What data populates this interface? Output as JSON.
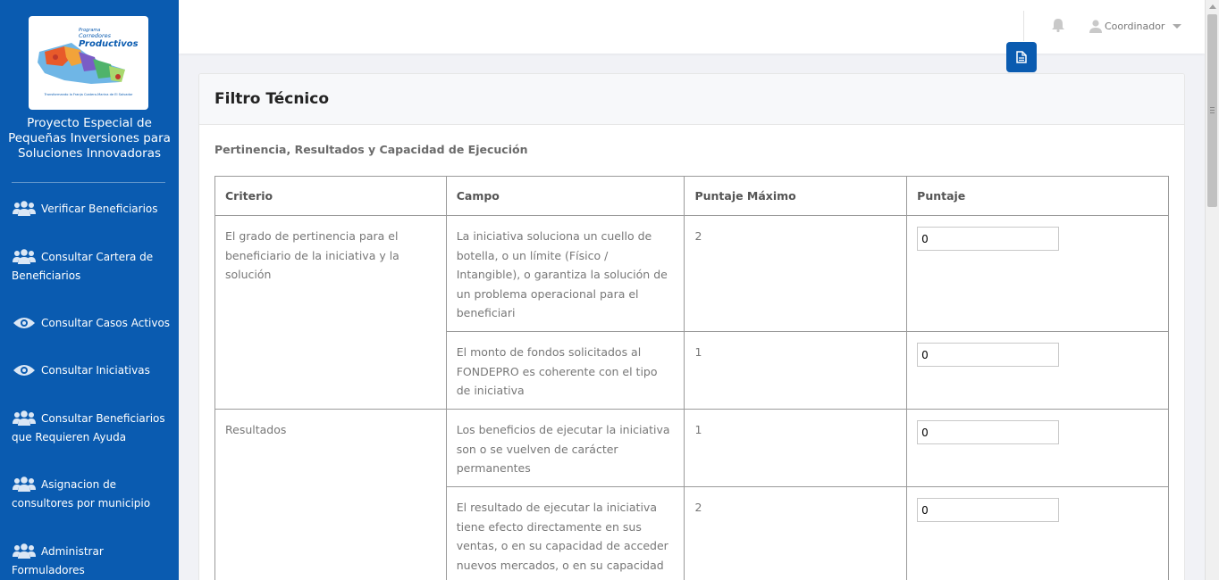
{
  "sidebar": {
    "logo": {
      "line1": "Programa",
      "line2": "Corredores",
      "line3": "Productivos",
      "tagline": "Transformando la Franja Costero-Marina de El Salvador"
    },
    "title": "Proyecto Especial de Pequeñas Inversiones para Soluciones Innovadoras",
    "items": [
      {
        "icon": "users-icon",
        "label": "Verificar Beneficiarios"
      },
      {
        "icon": "users-icon",
        "label": "Consultar Cartera de Beneficiarios"
      },
      {
        "icon": "eye-icon",
        "label": "Consultar Casos Activos"
      },
      {
        "icon": "eye-icon",
        "label": "Consultar Iniciativas"
      },
      {
        "icon": "users-icon",
        "label": "Consultar Beneficiarios que Requieren Ayuda"
      },
      {
        "icon": "users-icon",
        "label": "Asignacion de consultores por municipio"
      },
      {
        "icon": "users-icon",
        "label": "Administrar Formuladores"
      }
    ]
  },
  "topbar": {
    "user_name": "Coordinador",
    "icons": [
      "bell-icon",
      "user-icon",
      "document-icon"
    ]
  },
  "card": {
    "title": "Filtro Técnico",
    "section": "Pertinencia, Resultados y Capacidad de Ejecución",
    "columns": [
      "Criterio",
      "Campo",
      "Puntaje Máximo",
      "Puntaje"
    ],
    "criteria": [
      {
        "label": "El grado de pertinencia para el beneficiario de la iniciativa y la solución"
      },
      {
        "label": "Resultados"
      }
    ],
    "rows": [
      {
        "campo": "La iniciativa soluciona un cuello de botella, o un límite (Físico / Intangible), o garantiza la solución de un problema operacional para el beneficiari",
        "max": "2",
        "score": "0"
      },
      {
        "campo": "El monto de fondos solicitados al FONDEPRO es coherente con el tipo de iniciativa",
        "max": "1",
        "score": "0"
      },
      {
        "campo": "Los beneficios de ejecutar la iniciativa son o se vuelven de carácter permanentes",
        "max": "1",
        "score": "0"
      },
      {
        "campo": "El resultado de ejecutar la iniciativa tiene efecto directamente en sus ventas, o en su capacidad de acceder nuevos mercados, o en su capacidad",
        "max": "2",
        "score": "0"
      }
    ]
  }
}
